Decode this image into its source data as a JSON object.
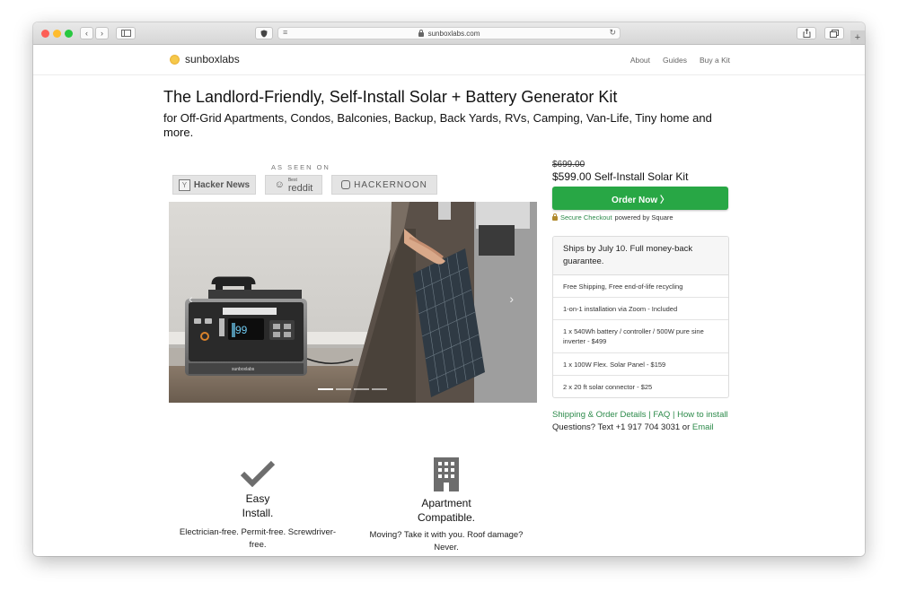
{
  "browser": {
    "url": "sunboxlabs.com",
    "colors": {
      "close": "#fd5f57",
      "minimize": "#febc2e",
      "zoom": "#28c840"
    }
  },
  "site": {
    "brand": "sunboxlabs",
    "nav": [
      "About",
      "Guides",
      "Buy a Kit"
    ]
  },
  "hero": {
    "title": "The Landlord-Friendly, Self-Install Solar + Battery Generator Kit",
    "subtitle": "for Off-Grid Apartments, Condos, Balconies, Backup, Back Yards, RVs, Camping, Van-Life, Tiny home and more.",
    "as_seen_on": "AS SEEN ON",
    "press": [
      "Hacker News",
      "reddit",
      "HACKERNOON"
    ],
    "press_reddit_prefix": "Best",
    "station_brand": "sunboxlabs",
    "station_display": "99",
    "carousel_slides": 4,
    "carousel_active": 1
  },
  "purchase": {
    "old_price": "$699.00",
    "price": "$599.00 Self-Install Solar Kit",
    "order_button": "Order Now 〉",
    "secure_link": "Secure Checkout",
    "secure_suffix": "powered by Square",
    "accent": "#28a745"
  },
  "details": {
    "ships": "Ships by July 10. Full money-back guarantee.",
    "items": [
      "Free Shipping, Free end-of-life recycling",
      "1-on-1 installation via Zoom - Included",
      "1 x 540Wh battery / controller / 500W pure sine inverter - $499",
      "1 x 100W Flex. Solar Panel - $159",
      "2 x 20 ft solar connector - $25"
    ]
  },
  "links": {
    "shipping": "Shipping & Order Details",
    "sep1": " | ",
    "faq": "FAQ",
    "sep2": " | ",
    "install": "How to install",
    "questions": "Questions? Text +1 917 704 3031 or ",
    "email": "Email"
  },
  "features": [
    {
      "title_line1": "Easy",
      "title_line2": "Install.",
      "desc": "Electrician-free. Permit-free. Screwdriver-free."
    },
    {
      "title_line1": "Apartment",
      "title_line2": "Compatible.",
      "desc": "Moving? Take it with you. Roof damage? Never."
    }
  ]
}
